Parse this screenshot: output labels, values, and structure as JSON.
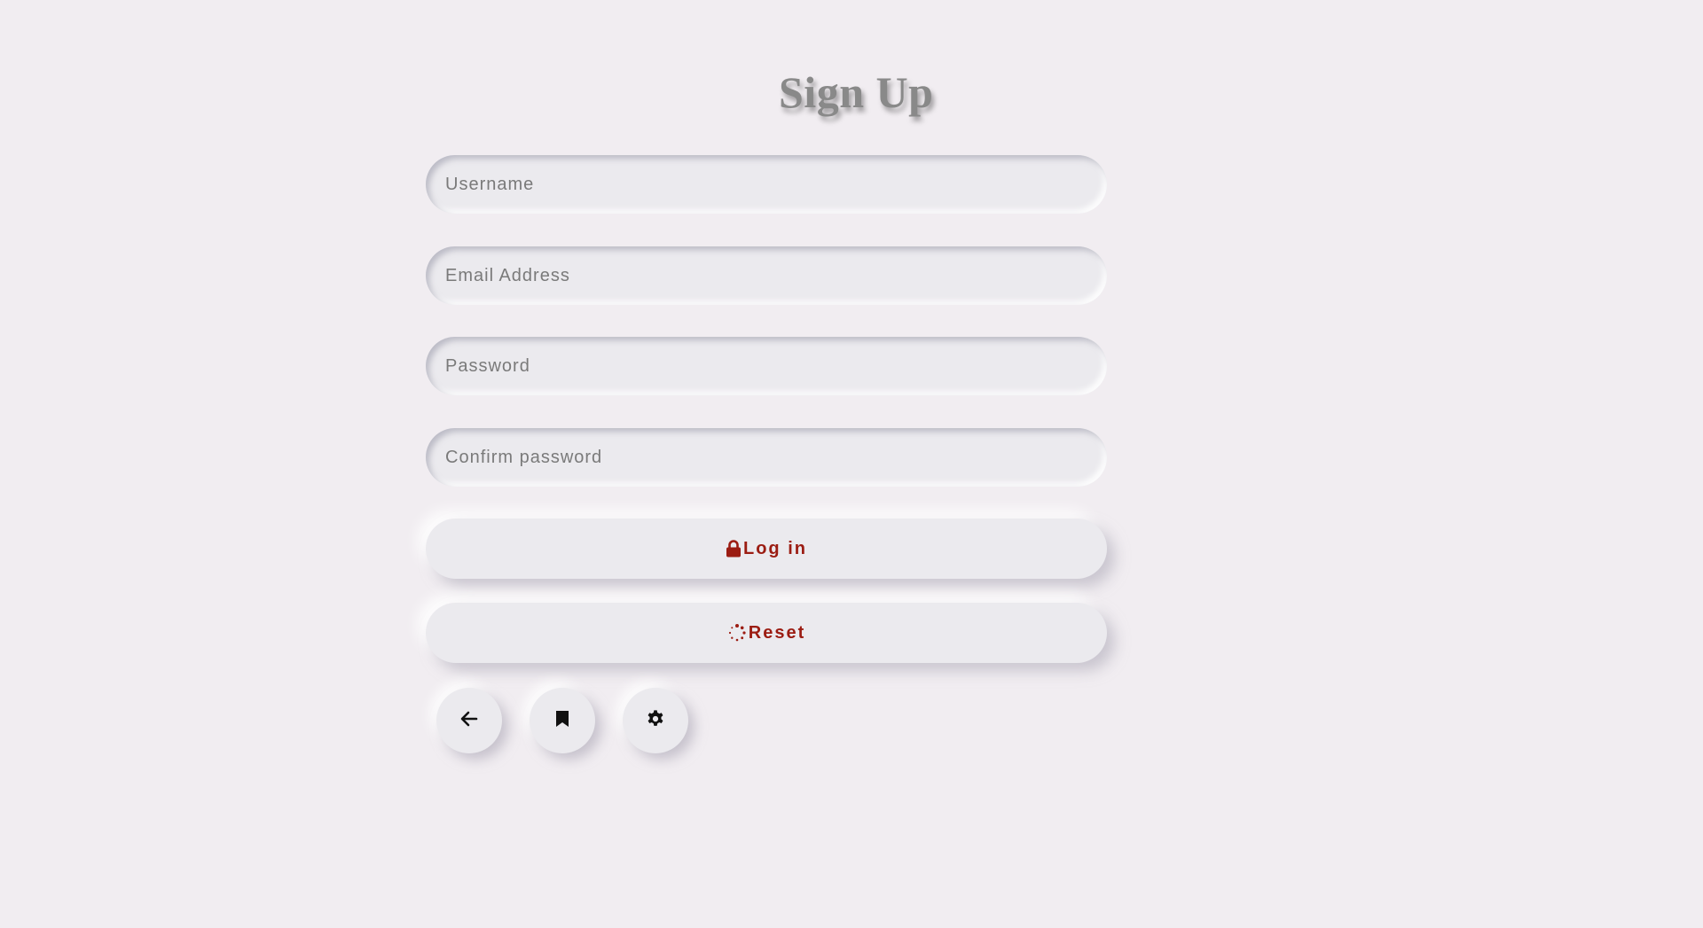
{
  "form": {
    "title": "Sign Up",
    "fields": {
      "username_placeholder": "Username",
      "email_placeholder": "Email Address",
      "password_placeholder": "Password",
      "confirm_password_placeholder": "Confirm password"
    },
    "buttons": {
      "login_label": "Log in",
      "login_icon": "lock-icon",
      "reset_label": "Reset",
      "reset_icon": "spinner-icon"
    },
    "icon_buttons": [
      "back-arrow-icon",
      "bookmark-icon",
      "gear-icon"
    ]
  },
  "colors": {
    "background": "#f1edf1",
    "surface": "#ebeaee",
    "accent": "#9b1c12",
    "title": "#898989"
  }
}
